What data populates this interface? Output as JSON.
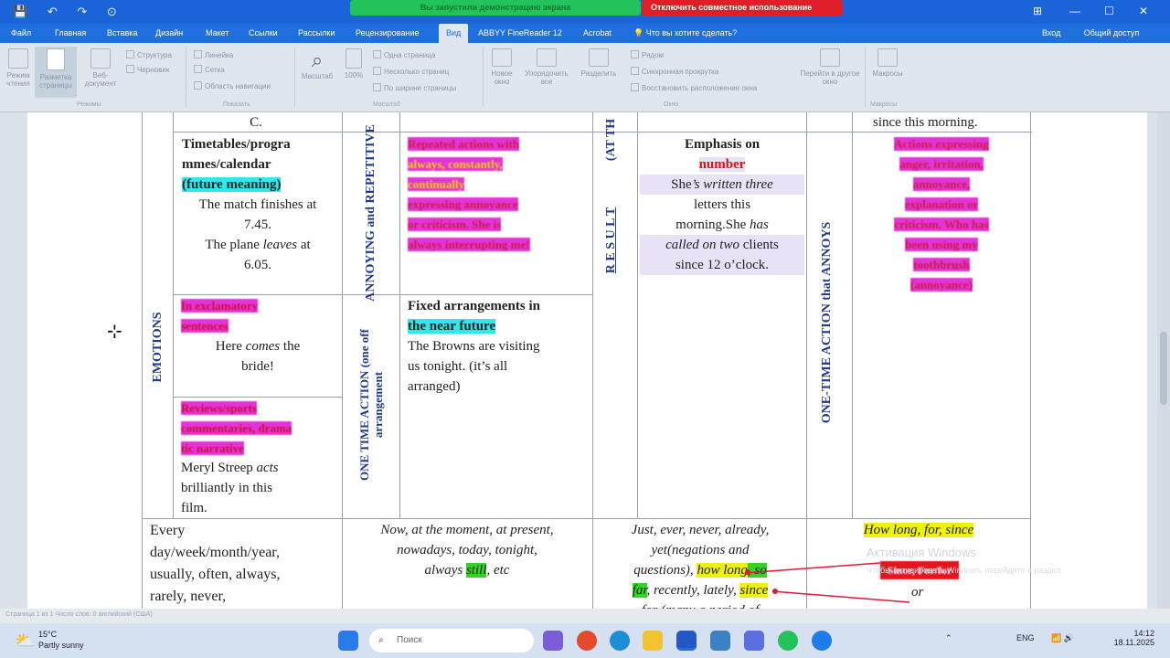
{
  "window": {
    "quick_access": [
      "💾",
      "↶",
      "↷",
      "⊙"
    ],
    "share_banner": "Вы запустили демонстрацию экрана",
    "stop_sharing": "Отключить совместное использование",
    "controls": [
      "⊞",
      "—",
      "☐",
      "✕"
    ]
  },
  "tabs": [
    "Файл",
    "Главная",
    "Вставка",
    "Дизайн",
    "Макет",
    "Ссылки",
    "Рассылки",
    "Рецензирование",
    "Вид",
    "ABBYY FineReader 12",
    "Acrobat",
    "Что вы хотите сделать?"
  ],
  "tabs_active": "Вид",
  "tabs_right": [
    "Вход",
    "Общий доступ"
  ],
  "ribbon": {
    "buttons": [
      "Режим чтения",
      "Разметка страницы",
      "Веб-документ",
      "Масштаб",
      "100%",
      "Новое окно",
      "Упорядочить все",
      "Разделить",
      "Перейти в другое окно",
      "Макросы"
    ],
    "checkboxes": [
      "Структура",
      "Черновик",
      "Линейка",
      "Сетка",
      "Область навигации",
      "Одна страница",
      "Несколько страниц",
      "По ширине страницы",
      "Рядом",
      "Синхронная прокрутка",
      "Восстановить расположение окна"
    ],
    "groups": [
      "Режимы",
      "Показать",
      "Масштаб",
      "Окно",
      "Макросы"
    ]
  },
  "doc": {
    "top_c": "C.",
    "top_since": "since this morning.",
    "timetables_1": "Timetables/progra",
    "timetables_2": "mmes/calendar",
    "future_meaning": "(future meaning)",
    "match_1": "The match finishes at",
    "match_2": "7.45.",
    "plane_1": "The plane ",
    "plane_leaves": "leaves",
    "plane_2": " at",
    "plane_3": "6.05.",
    "annoying_label": "ANNOYING and REPETITIVE",
    "repeated_1": "Repeated actions with",
    "repeated_always": "always, constantly,",
    "repeated_3": "continually",
    "repeated_4": "expressing annoyance",
    "repeated_5": "or criticism. She is",
    "repeated_6": "always interrupting me!",
    "at_the_label": "(AT TH",
    "result_label": "R E S U L T",
    "emphasis": "Emphasis on",
    "number": "number",
    "she_1": "She",
    "she_2": "’s written three",
    "letters_1": "letters this",
    "letters_2": "morning.She ",
    "has": "has",
    "called": "called on two",
    "clients": " clients",
    "since12": "since 12 o’clock.",
    "one_time_annoys": "ONE-TIME ACTION that ANNOYS",
    "actions_1": "Actions expressing",
    "actions_2": "anger, irritation,",
    "actions_3": "annoyance,",
    "actions_4": "explanation or",
    "actions_5": "criticism. Who has",
    "actions_6": "been using my",
    "actions_7": "toothbrush",
    "actions_8": "(annoyance)",
    "emotions": "EMOTIONS",
    "exclam_1": "In exclamatory",
    "exclam_2": "sentences",
    "here_1": "Here ",
    "comes": "comes",
    "here_2": " the",
    "bride": "bride!",
    "reviews_1": "Reviews/sports",
    "reviews_2": "commentaries, drama",
    "reviews_3": "tic narrative",
    "meryl_1": "Meryl Streep ",
    "acts": "acts",
    "meryl_2": "brilliantly in this",
    "meryl_3": "film.",
    "one_time_arr": "ONE TIME ACTION (one off arrangement",
    "fixed_1": "Fixed arrangements in",
    "fixed_2": "the near future",
    "browns_1": "The Browns are visiting",
    "browns_2": "us tonight. (it’s all",
    "browns_3": "arranged)",
    "every_1": "Every",
    "every_2": "day/week/month/year,",
    "every_3": "usually, often, always,",
    "every_4": "rarely, never,",
    "now_1": "Now, at the moment, at present,",
    "now_2": "nowadays, today, tonight,",
    "now_3": "always ",
    "still": "still",
    "now_4": ", etc",
    "just_1": "Just, ever, never, already,",
    "just_2": "yet(negations and",
    "just_3": "questions), ",
    "how_long": "how long",
    "so": ", so",
    "far": "far",
    "just_4": ", recently, lately, ",
    "since": "since",
    "just_5": "for (many a period of",
    "how_long_for_since": "How long, for, since",
    "since_for_box": "Since, For/for",
    "or": "or",
    "activation_1": "Активация Windows",
    "activation_2": "Чтобы активировать Windows, перейдите в раздел"
  },
  "statusbar": "Страница 1 из 1   Число слов: 0   английский (США)",
  "taskbar": {
    "temp": "15°C",
    "weather": "Partly sunny",
    "search": "Поиск",
    "lang": "ENG",
    "time": "14:12",
    "date": "18.11.2025"
  },
  "colors": {
    "accent": "#1f6fe0",
    "magenta": "#e433d8",
    "cyan": "#2ee8f0",
    "yellow": "#eef012",
    "green": "#33d426",
    "red": "#e01010"
  }
}
